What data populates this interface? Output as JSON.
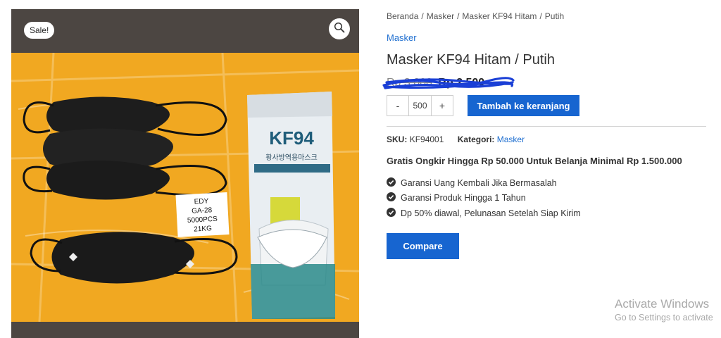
{
  "gallery": {
    "sale_badge": "Sale!",
    "zoom_icon": "magnifier-icon",
    "photo": {
      "box_label_lines": [
        "EDY",
        "GA-28",
        "5000PCS",
        "21KG"
      ],
      "package_brand": "KF94",
      "package_korean_text": "황사방역용마스크"
    }
  },
  "breadcrumb": {
    "items": [
      "Beranda",
      "Masker",
      "Masker KF94 Hitam",
      "Putih"
    ],
    "separator": "/"
  },
  "category_link": "Masker",
  "product": {
    "title": "Masker KF94 Hitam / Putih",
    "price_old": "Rp 3.000",
    "price_new": "Rp 2.500"
  },
  "cart": {
    "minus": "-",
    "quantity": "500",
    "plus": "+",
    "add_to_cart_label": "Tambah ke keranjang"
  },
  "meta": {
    "sku_label": "SKU:",
    "sku_value": "KF94001",
    "category_label": "Kategori:",
    "category_value": "Masker"
  },
  "promo_text": "Gratis Ongkir Hingga Rp 50.000 Untuk Belanja Minimal Rp 1.500.000",
  "features": [
    "Garansi Uang Kembali Jika Bermasalah",
    "Garansi Produk Hingga 1 Tahun",
    "Dp 50% diawal, Pelunasan Setelah Siap Kirim"
  ],
  "compare_label": "Compare",
  "windows_watermark": {
    "line1": "Activate Windows",
    "line2": "Go to Settings to activate"
  },
  "colors": {
    "primary_button": "#1765d0",
    "link": "#1f6fd0",
    "scribble": "#1a3fd6",
    "gallery_background": "#4c4642",
    "box_orange": "#f0a318"
  }
}
